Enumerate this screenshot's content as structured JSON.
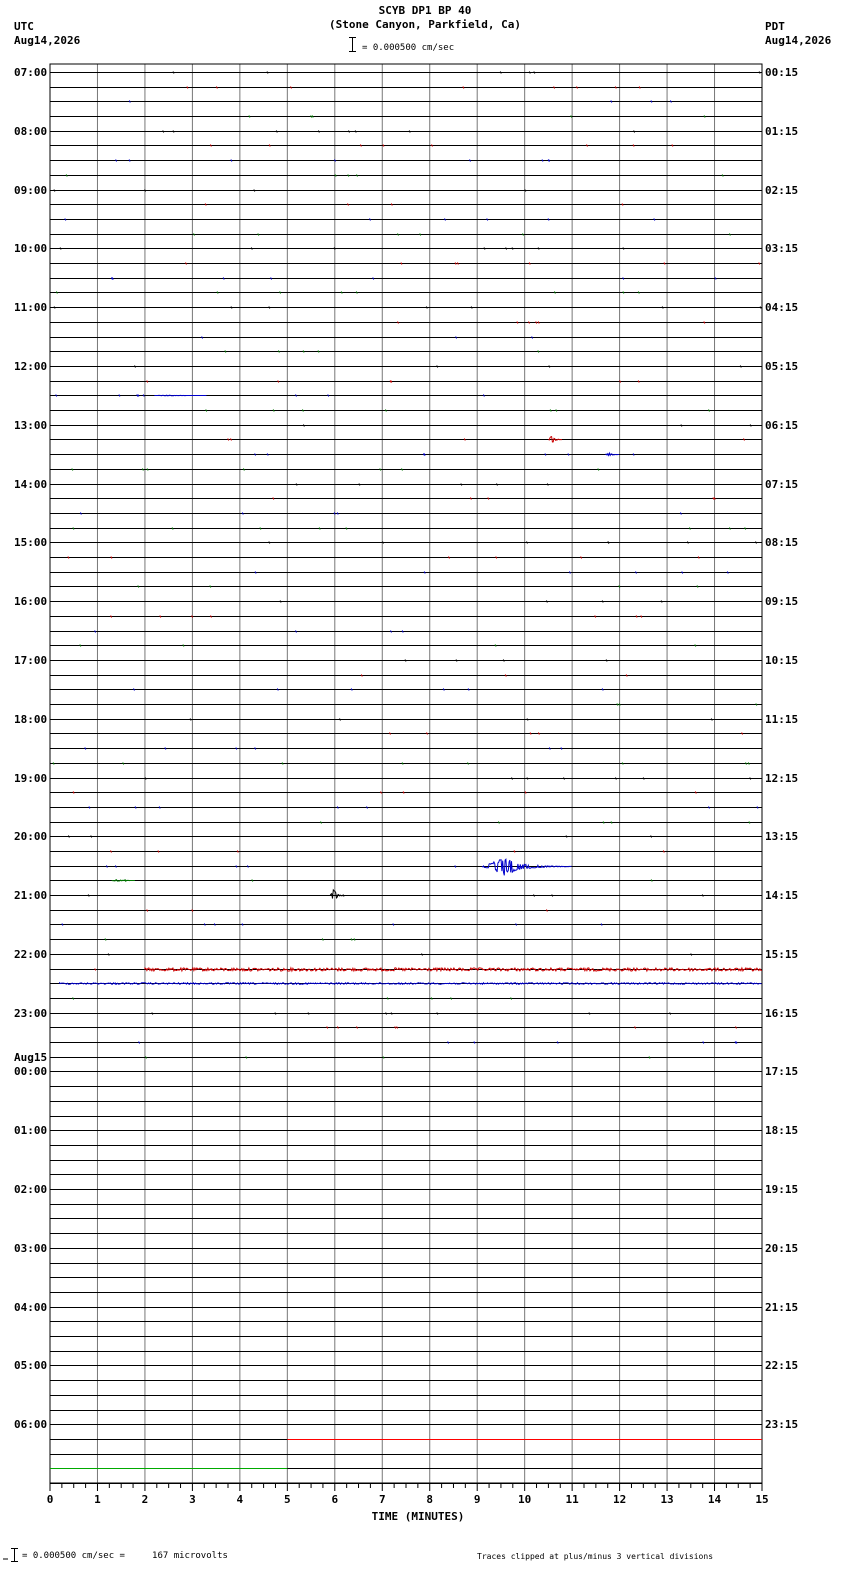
{
  "header": {
    "title": "SCYB DP1 BP 40",
    "subtitle": "(Stone Canyon, Parkfield, Ca)",
    "scale_label": "= 0.000500 cm/sec",
    "left_tz": "UTC",
    "left_date": "Aug14,2026",
    "right_tz": "PDT",
    "right_date": "Aug14,2026"
  },
  "footer": {
    "scale_text": "= 0.000500 cm/sec =     167 microvolts",
    "clip_note": "Traces clipped at plus/minus 3 vertical divisions"
  },
  "chart_data": {
    "type": "seismogram_helicorder",
    "xlabel": "TIME (MINUTES)",
    "xlim": [
      0,
      15
    ],
    "x_ticks": [
      0,
      1,
      2,
      3,
      4,
      5,
      6,
      7,
      8,
      9,
      10,
      11,
      12,
      13,
      14,
      15
    ],
    "rows_per_hour": 4,
    "row_count": 96,
    "trace_colors": [
      "#000000",
      "#cc0000",
      "#0000cc",
      "#007700"
    ],
    "grid_color": "#000000",
    "left_labels": [
      {
        "row": 0,
        "text": "07:00"
      },
      {
        "row": 4,
        "text": "08:00"
      },
      {
        "row": 8,
        "text": "09:00"
      },
      {
        "row": 12,
        "text": "10:00"
      },
      {
        "row": 16,
        "text": "11:00"
      },
      {
        "row": 20,
        "text": "12:00"
      },
      {
        "row": 24,
        "text": "13:00"
      },
      {
        "row": 28,
        "text": "14:00"
      },
      {
        "row": 32,
        "text": "15:00"
      },
      {
        "row": 36,
        "text": "16:00"
      },
      {
        "row": 40,
        "text": "17:00"
      },
      {
        "row": 44,
        "text": "18:00"
      },
      {
        "row": 48,
        "text": "19:00"
      },
      {
        "row": 52,
        "text": "20:00"
      },
      {
        "row": 56,
        "text": "21:00"
      },
      {
        "row": 60,
        "text": "22:00"
      },
      {
        "row": 64,
        "text": "23:00"
      },
      {
        "row": 68,
        "text": "00:00",
        "date": "Aug15"
      },
      {
        "row": 72,
        "text": "01:00"
      },
      {
        "row": 76,
        "text": "02:00"
      },
      {
        "row": 80,
        "text": "03:00"
      },
      {
        "row": 84,
        "text": "04:00"
      },
      {
        "row": 88,
        "text": "05:00"
      },
      {
        "row": 92,
        "text": "06:00"
      }
    ],
    "right_labels": [
      "00:15",
      "01:15",
      "02:15",
      "03:15",
      "04:15",
      "05:15",
      "06:15",
      "07:15",
      "08:15",
      "09:15",
      "10:15",
      "11:15",
      "12:15",
      "13:15",
      "14:15",
      "15:15",
      "16:15",
      "17:15",
      "18:15",
      "19:15",
      "20:15",
      "21:15",
      "22:15",
      "23:15"
    ],
    "events": [
      {
        "row": 22,
        "start_min": 2.2,
        "end_min": 3.3,
        "amplitude": 0.4,
        "color": "#0000cc"
      },
      {
        "row": 25,
        "start_min": 10.5,
        "end_min": 10.8,
        "amplitude": 4,
        "color": "#cc0000"
      },
      {
        "row": 26,
        "start_min": 11.7,
        "end_min": 12.0,
        "amplitude": 2,
        "color": "#0000cc"
      },
      {
        "row": 54,
        "start_min": 9.1,
        "end_min": 11.0,
        "amplitude": 9,
        "color": "#0000cc"
      },
      {
        "row": 55,
        "start_min": 1.3,
        "end_min": 1.8,
        "amplitude": 1,
        "color": "#007700"
      },
      {
        "row": 56,
        "start_min": 5.9,
        "end_min": 6.2,
        "amplitude": 7,
        "color": "#000000"
      }
    ],
    "noisy_rows": [
      {
        "row": 61,
        "start_min": 2.0,
        "end_min": 15,
        "amplitude": 1.6,
        "color": "#cc0000"
      },
      {
        "row": 62,
        "start_min": 0.2,
        "end_min": 15,
        "amplitude": 0.8,
        "color": "#0000cc"
      }
    ],
    "flat_segments": [
      {
        "row": 93,
        "start_min": 5.0,
        "end_min": 15,
        "color": "#ff0000"
      },
      {
        "row": 95,
        "start_min": 0.0,
        "end_min": 5.0,
        "color": "#00aa00"
      }
    ]
  }
}
